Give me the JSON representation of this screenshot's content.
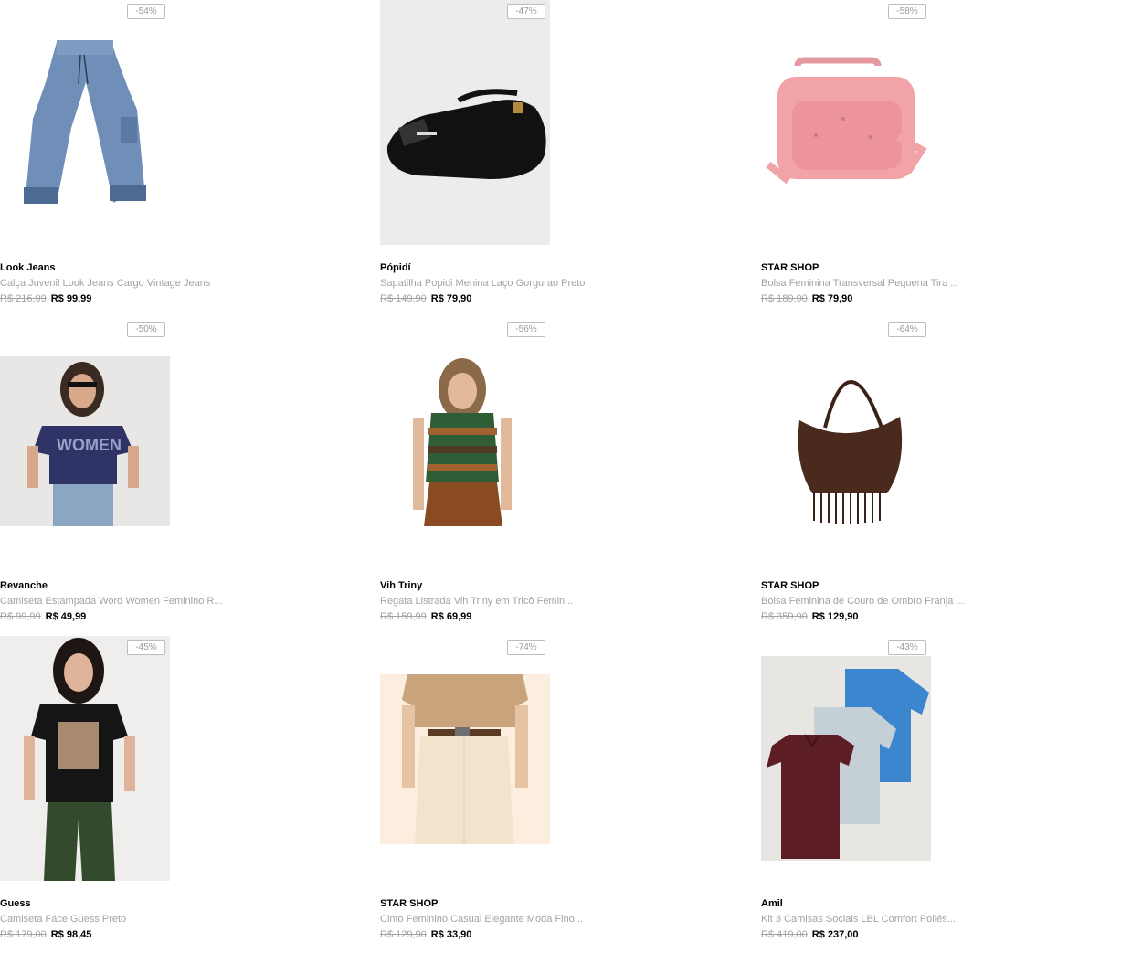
{
  "products": [
    {
      "badge": "-54%",
      "brand": "Look Jeans",
      "name": "Calça Juvenil Look Jeans Cargo Vintage Jeans",
      "old_price": "R$ 216,99",
      "price": "R$ 99,99",
      "image": "jeans"
    },
    {
      "badge": "-47%",
      "brand": "Pópidí",
      "name": "Sapatilha Popidi Menina Laço Gorgurao Preto",
      "old_price": "R$ 149,90",
      "price": "R$ 79,90",
      "image": "shoe"
    },
    {
      "badge": "-58%",
      "brand": "STAR SHOP",
      "name": "Bolsa Feminina Transversal Pequena Tira ...",
      "old_price": "R$ 189,90",
      "price": "R$ 79,90",
      "image": "pink-bag"
    },
    {
      "badge": "-50%",
      "brand": "Revanche",
      "name": "Camiseta Estampada Word Women Feminino R...",
      "old_price": "R$ 99,99",
      "price": "R$ 49,99",
      "image": "tshirt-woman"
    },
    {
      "badge": "-56%",
      "brand": "Vih Triny",
      "name": "Regata Listrada Vih Triny em Tricô Femin...",
      "old_price": "R$ 159,99",
      "price": "R$ 69,99",
      "image": "striped-top"
    },
    {
      "badge": "-64%",
      "brand": "STAR SHOP",
      "name": "Bolsa Feminina de Couro de Ombro Franja ...",
      "old_price": "R$ 359,90",
      "price": "R$ 129,90",
      "image": "fringe-bag"
    },
    {
      "badge": "-45%",
      "brand": "Guess",
      "name": "Camiseta Face Guess Preto",
      "old_price": "R$ 179,00",
      "price": "R$ 98,45",
      "image": "black-tee"
    },
    {
      "badge": "-74%",
      "brand": "STAR SHOP",
      "name": "Cinto Feminino Casual Elegante Moda Fino...",
      "old_price": "R$ 129,90",
      "price": "R$ 33,90",
      "image": "belt"
    },
    {
      "badge": "-43%",
      "brand": "Amil",
      "name": "Kit 3 Camisas Sociais LBL Comfort Poliés...",
      "old_price": "R$ 419,00",
      "price": "R$ 237,00",
      "image": "shirts"
    }
  ]
}
